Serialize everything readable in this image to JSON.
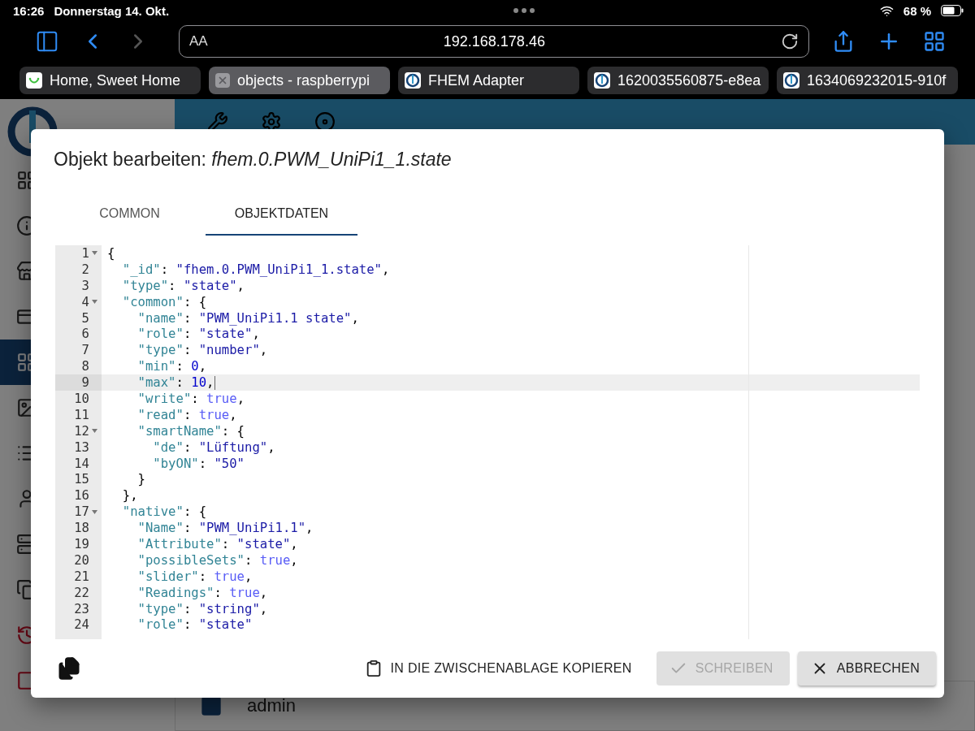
{
  "status_bar": {
    "time": "16:26",
    "date": "Donnerstag 14. Okt.",
    "battery": "68 %"
  },
  "browser": {
    "text_size": "AA",
    "address": "192.168.178.46",
    "forward_disabled": true,
    "tabs": [
      {
        "title": "Home, Sweet Home",
        "selected": false,
        "kind": "smiley"
      },
      {
        "title": "objects - raspberrypi",
        "selected": true
      },
      {
        "title": "FHEM Adapter",
        "selected": false,
        "kind": "iobroker"
      },
      {
        "title": "1620035560875-e8ea",
        "selected": false,
        "kind": "iobroker"
      },
      {
        "title": "1634069232015-910f",
        "selected": false,
        "kind": "iobroker"
      }
    ]
  },
  "sidebar": {
    "items": [
      {
        "selected": false
      },
      {
        "selected": false
      },
      {
        "selected": false
      },
      {
        "selected": false
      },
      {
        "selected": true
      },
      {
        "selected": false
      },
      {
        "selected": false
      },
      {
        "selected": false
      },
      {
        "selected": false
      },
      {
        "selected": false
      },
      {
        "selected": false
      },
      {
        "selected": false
      }
    ]
  },
  "background": {
    "user": "admin"
  },
  "dialog": {
    "title_prefix": "Objekt bearbeiten: ",
    "title_object": "fhem.0.PWM_UniPi1_1.state",
    "tabs": [
      {
        "label": "COMMON",
        "selected": false
      },
      {
        "label": "OBJEKTDATEN",
        "selected": true
      }
    ],
    "lines": [
      {
        "number": "1",
        "foldable": true,
        "active": false,
        "tokens": [
          {
            "kind": "punct",
            "text": "{"
          }
        ]
      },
      {
        "number": "2",
        "foldable": false,
        "active": false,
        "tokens": [
          {
            "kind": "key",
            "text": "  \"_id\""
          },
          {
            "kind": "punct",
            "text": ": "
          },
          {
            "kind": "string",
            "text": "\"fhem.0.PWM_UniPi1_1.state\""
          },
          {
            "kind": "punct",
            "text": ","
          }
        ]
      },
      {
        "number": "3",
        "foldable": false,
        "active": false,
        "tokens": [
          {
            "kind": "key",
            "text": "  \"type\""
          },
          {
            "kind": "punct",
            "text": ": "
          },
          {
            "kind": "string",
            "text": "\"state\""
          },
          {
            "kind": "punct",
            "text": ","
          }
        ]
      },
      {
        "number": "4",
        "foldable": true,
        "active": false,
        "tokens": [
          {
            "kind": "key",
            "text": "  \"common\""
          },
          {
            "kind": "punct",
            "text": ": {"
          }
        ]
      },
      {
        "number": "5",
        "foldable": false,
        "active": false,
        "tokens": [
          {
            "kind": "key",
            "text": "    \"name\""
          },
          {
            "kind": "punct",
            "text": ": "
          },
          {
            "kind": "string",
            "text": "\"PWM_UniPi1.1 state\""
          },
          {
            "kind": "punct",
            "text": ","
          }
        ]
      },
      {
        "number": "6",
        "foldable": false,
        "active": false,
        "tokens": [
          {
            "kind": "key",
            "text": "    \"role\""
          },
          {
            "kind": "punct",
            "text": ": "
          },
          {
            "kind": "string",
            "text": "\"state\""
          },
          {
            "kind": "punct",
            "text": ","
          }
        ]
      },
      {
        "number": "7",
        "foldable": false,
        "active": false,
        "tokens": [
          {
            "kind": "key",
            "text": "    \"type\""
          },
          {
            "kind": "punct",
            "text": ": "
          },
          {
            "kind": "string",
            "text": "\"number\""
          },
          {
            "kind": "punct",
            "text": ","
          }
        ]
      },
      {
        "number": "8",
        "foldable": false,
        "active": false,
        "tokens": [
          {
            "kind": "key",
            "text": "    \"min\""
          },
          {
            "kind": "punct",
            "text": ": "
          },
          {
            "kind": "number",
            "text": "0"
          },
          {
            "kind": "punct",
            "text": ","
          }
        ]
      },
      {
        "number": "9",
        "foldable": false,
        "active": true,
        "tokens": [
          {
            "kind": "key",
            "text": "    \"max\""
          },
          {
            "kind": "punct",
            "text": ": "
          },
          {
            "kind": "number",
            "text": "10"
          },
          {
            "kind": "punct",
            "text": ","
          }
        ]
      },
      {
        "number": "10",
        "foldable": false,
        "active": false,
        "tokens": [
          {
            "kind": "key",
            "text": "    \"write\""
          },
          {
            "kind": "punct",
            "text": ": "
          },
          {
            "kind": "boolean",
            "text": "true"
          },
          {
            "kind": "punct",
            "text": ","
          }
        ]
      },
      {
        "number": "11",
        "foldable": false,
        "active": false,
        "tokens": [
          {
            "kind": "key",
            "text": "    \"read\""
          },
          {
            "kind": "punct",
            "text": ": "
          },
          {
            "kind": "boolean",
            "text": "true"
          },
          {
            "kind": "punct",
            "text": ","
          }
        ]
      },
      {
        "number": "12",
        "foldable": true,
        "active": false,
        "tokens": [
          {
            "kind": "key",
            "text": "    \"smartName\""
          },
          {
            "kind": "punct",
            "text": ": {"
          }
        ]
      },
      {
        "number": "13",
        "foldable": false,
        "active": false,
        "tokens": [
          {
            "kind": "key",
            "text": "      \"de\""
          },
          {
            "kind": "punct",
            "text": ": "
          },
          {
            "kind": "string",
            "text": "\"Lüftung\""
          },
          {
            "kind": "punct",
            "text": ","
          }
        ]
      },
      {
        "number": "14",
        "foldable": false,
        "active": false,
        "tokens": [
          {
            "kind": "key",
            "text": "      \"byON\""
          },
          {
            "kind": "punct",
            "text": ": "
          },
          {
            "kind": "string",
            "text": "\"50\""
          }
        ]
      },
      {
        "number": "15",
        "foldable": false,
        "active": false,
        "tokens": [
          {
            "kind": "punct",
            "text": "    }"
          }
        ]
      },
      {
        "number": "16",
        "foldable": false,
        "active": false,
        "tokens": [
          {
            "kind": "punct",
            "text": "  },"
          }
        ]
      },
      {
        "number": "17",
        "foldable": true,
        "active": false,
        "tokens": [
          {
            "kind": "key",
            "text": "  \"native\""
          },
          {
            "kind": "punct",
            "text": ": {"
          }
        ]
      },
      {
        "number": "18",
        "foldable": false,
        "active": false,
        "tokens": [
          {
            "kind": "key",
            "text": "    \"Name\""
          },
          {
            "kind": "punct",
            "text": ": "
          },
          {
            "kind": "string",
            "text": "\"PWM_UniPi1.1\""
          },
          {
            "kind": "punct",
            "text": ","
          }
        ]
      },
      {
        "number": "19",
        "foldable": false,
        "active": false,
        "tokens": [
          {
            "kind": "key",
            "text": "    \"Attribute\""
          },
          {
            "kind": "punct",
            "text": ": "
          },
          {
            "kind": "string",
            "text": "\"state\""
          },
          {
            "kind": "punct",
            "text": ","
          }
        ]
      },
      {
        "number": "20",
        "foldable": false,
        "active": false,
        "tokens": [
          {
            "kind": "key",
            "text": "    \"possibleSets\""
          },
          {
            "kind": "punct",
            "text": ": "
          },
          {
            "kind": "boolean",
            "text": "true"
          },
          {
            "kind": "punct",
            "text": ","
          }
        ]
      },
      {
        "number": "21",
        "foldable": false,
        "active": false,
        "tokens": [
          {
            "kind": "key",
            "text": "    \"slider\""
          },
          {
            "kind": "punct",
            "text": ": "
          },
          {
            "kind": "boolean",
            "text": "true"
          },
          {
            "kind": "punct",
            "text": ","
          }
        ]
      },
      {
        "number": "22",
        "foldable": false,
        "active": false,
        "tokens": [
          {
            "kind": "key",
            "text": "    \"Readings\""
          },
          {
            "kind": "punct",
            "text": ": "
          },
          {
            "kind": "boolean",
            "text": "true"
          },
          {
            "kind": "punct",
            "text": ","
          }
        ]
      },
      {
        "number": "23",
        "foldable": false,
        "active": false,
        "tokens": [
          {
            "kind": "key",
            "text": "    \"type\""
          },
          {
            "kind": "punct",
            "text": ": "
          },
          {
            "kind": "string",
            "text": "\"string\""
          },
          {
            "kind": "punct",
            "text": ","
          }
        ]
      },
      {
        "number": "24",
        "foldable": false,
        "active": false,
        "tokens": [
          {
            "kind": "key",
            "text": "    \"role\""
          },
          {
            "kind": "punct",
            "text": ": "
          },
          {
            "kind": "string",
            "text": "\"state\""
          }
        ]
      }
    ],
    "buttons": [
      {
        "label": "IN DIE ZWISCHENABLAGE KOPIEREN",
        "kind": "text",
        "disabled": false
      },
      {
        "label": "SCHREIBEN",
        "kind": "contained",
        "disabled": true
      },
      {
        "label": "ABBRECHEN",
        "kind": "contained",
        "disabled": false
      }
    ]
  }
}
